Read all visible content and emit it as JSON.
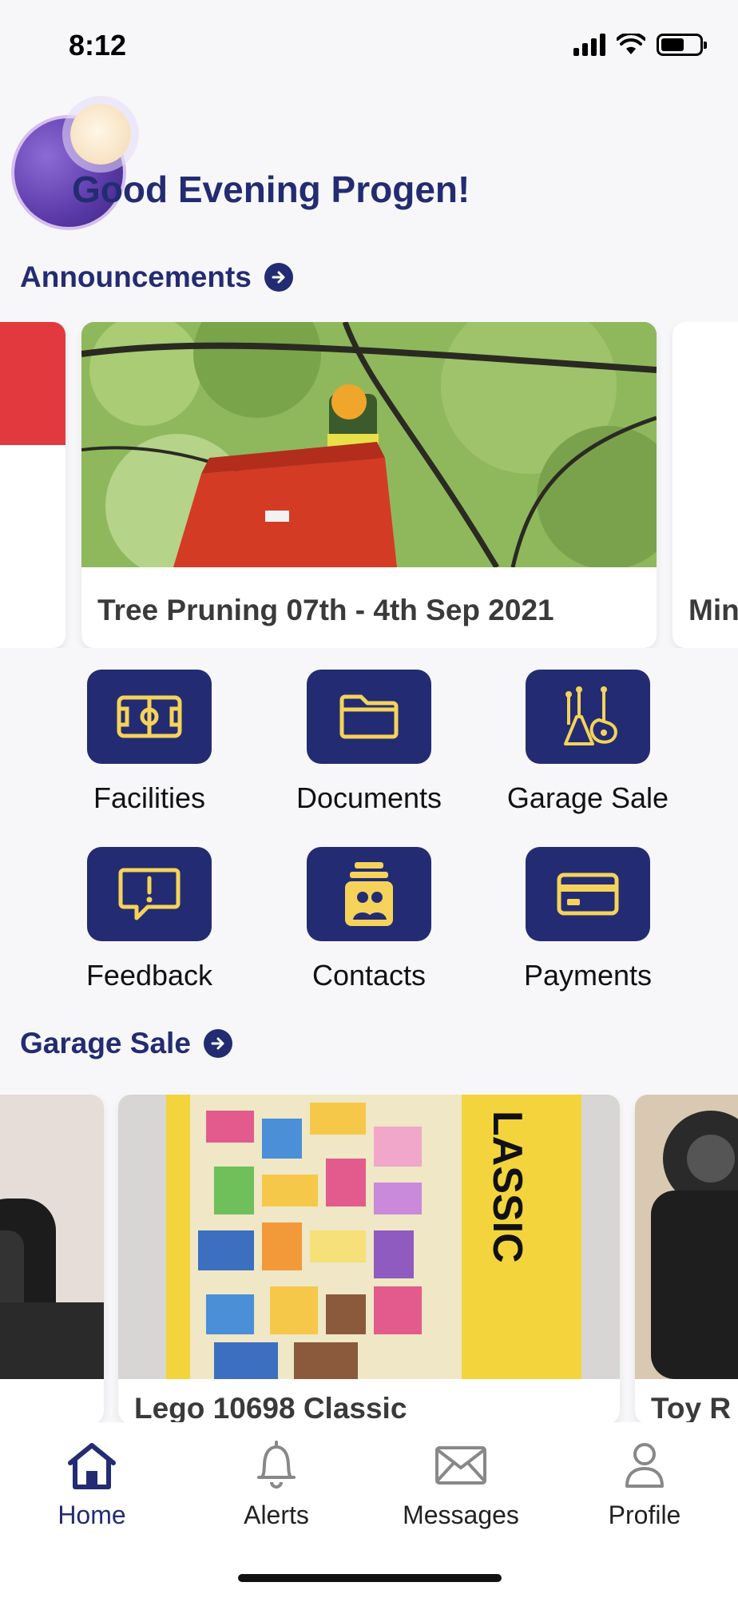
{
  "status": {
    "time": "8:12"
  },
  "greeting": "Good Evening Progen!",
  "announcements": {
    "title": "Announcements",
    "cards": [
      {
        "caption": "Tree Pruning 07th - 4th Sep 2021"
      },
      {
        "caption": "Min"
      }
    ]
  },
  "quick_actions": [
    {
      "label": "Facilities",
      "icon": "soccer-field-icon"
    },
    {
      "label": "Documents",
      "icon": "folder-icon"
    },
    {
      "label": "Garage Sale",
      "icon": "guitars-icon"
    },
    {
      "label": "Feedback",
      "icon": "feedback-bubble-icon"
    },
    {
      "label": "Contacts",
      "icon": "contacts-card-icon"
    },
    {
      "label": "Payments",
      "icon": "credit-card-icon"
    }
  ],
  "garage_sale": {
    "title": "Garage Sale",
    "items": [
      {
        "caption": ""
      },
      {
        "caption": "Lego 10698 Classic"
      },
      {
        "caption": "Toy R"
      }
    ]
  },
  "tabs": [
    {
      "label": "Home",
      "icon": "home-icon",
      "active": true
    },
    {
      "label": "Alerts",
      "icon": "bell-icon",
      "active": false
    },
    {
      "label": "Messages",
      "icon": "envelope-icon",
      "active": false
    },
    {
      "label": "Profile",
      "icon": "person-icon",
      "active": false
    }
  ],
  "colors": {
    "brand": "#232c72",
    "accent": "#f5d35a",
    "alert_red": "#e2393f"
  }
}
